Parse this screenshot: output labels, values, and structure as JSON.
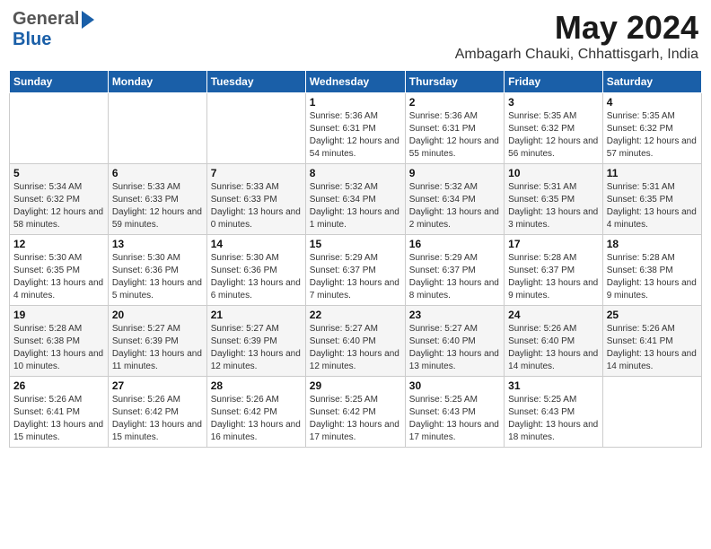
{
  "header": {
    "logo_general": "General",
    "logo_blue": "Blue",
    "month_year": "May 2024",
    "location": "Ambagarh Chauki, Chhattisgarh, India"
  },
  "days_of_week": [
    "Sunday",
    "Monday",
    "Tuesday",
    "Wednesday",
    "Thursday",
    "Friday",
    "Saturday"
  ],
  "weeks": [
    [
      {
        "day": "",
        "sunrise": "",
        "sunset": "",
        "daylight": ""
      },
      {
        "day": "",
        "sunrise": "",
        "sunset": "",
        "daylight": ""
      },
      {
        "day": "",
        "sunrise": "",
        "sunset": "",
        "daylight": ""
      },
      {
        "day": "1",
        "sunrise": "Sunrise: 5:36 AM",
        "sunset": "Sunset: 6:31 PM",
        "daylight": "Daylight: 12 hours and 54 minutes."
      },
      {
        "day": "2",
        "sunrise": "Sunrise: 5:36 AM",
        "sunset": "Sunset: 6:31 PM",
        "daylight": "Daylight: 12 hours and 55 minutes."
      },
      {
        "day": "3",
        "sunrise": "Sunrise: 5:35 AM",
        "sunset": "Sunset: 6:32 PM",
        "daylight": "Daylight: 12 hours and 56 minutes."
      },
      {
        "day": "4",
        "sunrise": "Sunrise: 5:35 AM",
        "sunset": "Sunset: 6:32 PM",
        "daylight": "Daylight: 12 hours and 57 minutes."
      }
    ],
    [
      {
        "day": "5",
        "sunrise": "Sunrise: 5:34 AM",
        "sunset": "Sunset: 6:32 PM",
        "daylight": "Daylight: 12 hours and 58 minutes."
      },
      {
        "day": "6",
        "sunrise": "Sunrise: 5:33 AM",
        "sunset": "Sunset: 6:33 PM",
        "daylight": "Daylight: 12 hours and 59 minutes."
      },
      {
        "day": "7",
        "sunrise": "Sunrise: 5:33 AM",
        "sunset": "Sunset: 6:33 PM",
        "daylight": "Daylight: 13 hours and 0 minutes."
      },
      {
        "day": "8",
        "sunrise": "Sunrise: 5:32 AM",
        "sunset": "Sunset: 6:34 PM",
        "daylight": "Daylight: 13 hours and 1 minute."
      },
      {
        "day": "9",
        "sunrise": "Sunrise: 5:32 AM",
        "sunset": "Sunset: 6:34 PM",
        "daylight": "Daylight: 13 hours and 2 minutes."
      },
      {
        "day": "10",
        "sunrise": "Sunrise: 5:31 AM",
        "sunset": "Sunset: 6:35 PM",
        "daylight": "Daylight: 13 hours and 3 minutes."
      },
      {
        "day": "11",
        "sunrise": "Sunrise: 5:31 AM",
        "sunset": "Sunset: 6:35 PM",
        "daylight": "Daylight: 13 hours and 4 minutes."
      }
    ],
    [
      {
        "day": "12",
        "sunrise": "Sunrise: 5:30 AM",
        "sunset": "Sunset: 6:35 PM",
        "daylight": "Daylight: 13 hours and 4 minutes."
      },
      {
        "day": "13",
        "sunrise": "Sunrise: 5:30 AM",
        "sunset": "Sunset: 6:36 PM",
        "daylight": "Daylight: 13 hours and 5 minutes."
      },
      {
        "day": "14",
        "sunrise": "Sunrise: 5:30 AM",
        "sunset": "Sunset: 6:36 PM",
        "daylight": "Daylight: 13 hours and 6 minutes."
      },
      {
        "day": "15",
        "sunrise": "Sunrise: 5:29 AM",
        "sunset": "Sunset: 6:37 PM",
        "daylight": "Daylight: 13 hours and 7 minutes."
      },
      {
        "day": "16",
        "sunrise": "Sunrise: 5:29 AM",
        "sunset": "Sunset: 6:37 PM",
        "daylight": "Daylight: 13 hours and 8 minutes."
      },
      {
        "day": "17",
        "sunrise": "Sunrise: 5:28 AM",
        "sunset": "Sunset: 6:37 PM",
        "daylight": "Daylight: 13 hours and 9 minutes."
      },
      {
        "day": "18",
        "sunrise": "Sunrise: 5:28 AM",
        "sunset": "Sunset: 6:38 PM",
        "daylight": "Daylight: 13 hours and 9 minutes."
      }
    ],
    [
      {
        "day": "19",
        "sunrise": "Sunrise: 5:28 AM",
        "sunset": "Sunset: 6:38 PM",
        "daylight": "Daylight: 13 hours and 10 minutes."
      },
      {
        "day": "20",
        "sunrise": "Sunrise: 5:27 AM",
        "sunset": "Sunset: 6:39 PM",
        "daylight": "Daylight: 13 hours and 11 minutes."
      },
      {
        "day": "21",
        "sunrise": "Sunrise: 5:27 AM",
        "sunset": "Sunset: 6:39 PM",
        "daylight": "Daylight: 13 hours and 12 minutes."
      },
      {
        "day": "22",
        "sunrise": "Sunrise: 5:27 AM",
        "sunset": "Sunset: 6:40 PM",
        "daylight": "Daylight: 13 hours and 12 minutes."
      },
      {
        "day": "23",
        "sunrise": "Sunrise: 5:27 AM",
        "sunset": "Sunset: 6:40 PM",
        "daylight": "Daylight: 13 hours and 13 minutes."
      },
      {
        "day": "24",
        "sunrise": "Sunrise: 5:26 AM",
        "sunset": "Sunset: 6:40 PM",
        "daylight": "Daylight: 13 hours and 14 minutes."
      },
      {
        "day": "25",
        "sunrise": "Sunrise: 5:26 AM",
        "sunset": "Sunset: 6:41 PM",
        "daylight": "Daylight: 13 hours and 14 minutes."
      }
    ],
    [
      {
        "day": "26",
        "sunrise": "Sunrise: 5:26 AM",
        "sunset": "Sunset: 6:41 PM",
        "daylight": "Daylight: 13 hours and 15 minutes."
      },
      {
        "day": "27",
        "sunrise": "Sunrise: 5:26 AM",
        "sunset": "Sunset: 6:42 PM",
        "daylight": "Daylight: 13 hours and 15 minutes."
      },
      {
        "day": "28",
        "sunrise": "Sunrise: 5:26 AM",
        "sunset": "Sunset: 6:42 PM",
        "daylight": "Daylight: 13 hours and 16 minutes."
      },
      {
        "day": "29",
        "sunrise": "Sunrise: 5:25 AM",
        "sunset": "Sunset: 6:42 PM",
        "daylight": "Daylight: 13 hours and 17 minutes."
      },
      {
        "day": "30",
        "sunrise": "Sunrise: 5:25 AM",
        "sunset": "Sunset: 6:43 PM",
        "daylight": "Daylight: 13 hours and 17 minutes."
      },
      {
        "day": "31",
        "sunrise": "Sunrise: 5:25 AM",
        "sunset": "Sunset: 6:43 PM",
        "daylight": "Daylight: 13 hours and 18 minutes."
      },
      {
        "day": "",
        "sunrise": "",
        "sunset": "",
        "daylight": ""
      }
    ]
  ]
}
